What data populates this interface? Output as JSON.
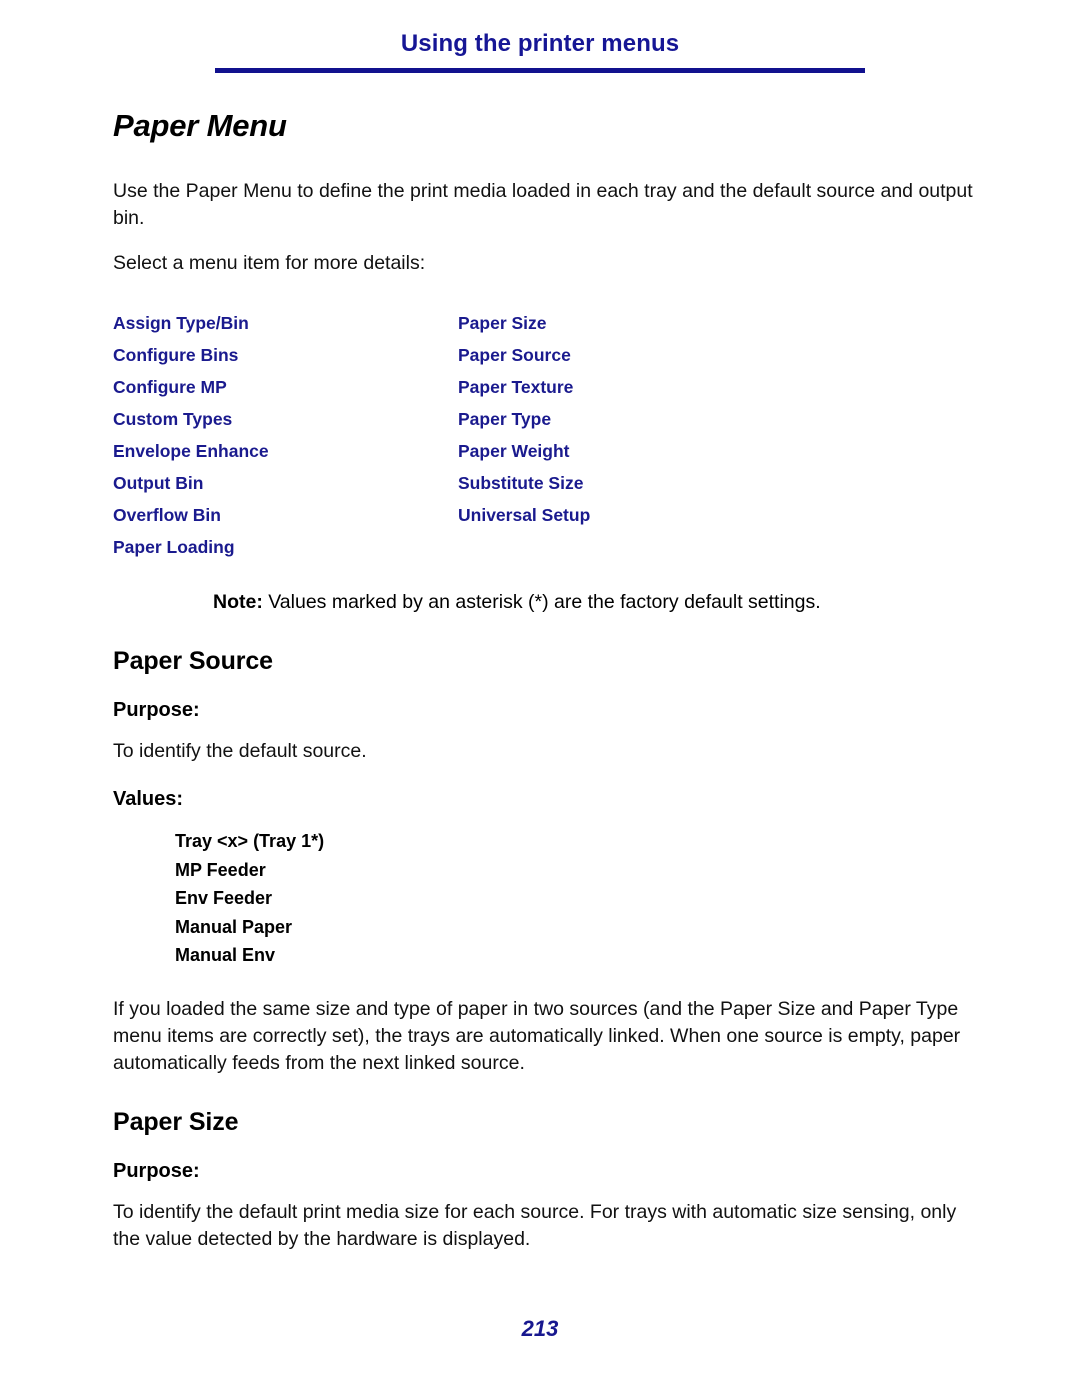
{
  "header": {
    "title": "Using the printer menus"
  },
  "document": {
    "title": "Paper Menu",
    "intro_paragraph": "Use the Paper Menu to define the print media loaded in each tray and the default source and output bin.",
    "select_prompt": "Select a menu item for more details:"
  },
  "menu_links": {
    "left_column": [
      "Assign Type/Bin",
      "Configure Bins",
      "Configure MP",
      "Custom Types",
      "Envelope Enhance",
      "Output Bin",
      "Overflow Bin",
      "Paper Loading"
    ],
    "right_column": [
      "Paper Size",
      "Paper Source",
      "Paper Texture",
      "Paper Type",
      "Paper Weight",
      "Substitute Size",
      "Universal Setup"
    ]
  },
  "note": {
    "label": "Note:",
    "text": "Values marked by an asterisk (*) are the factory default settings."
  },
  "paper_source_section": {
    "heading": "Paper Source",
    "purpose_label": "Purpose:",
    "purpose_text": "To identify the default source.",
    "values_label": "Values:",
    "values": [
      "Tray <x> (Tray 1*)",
      "MP Feeder",
      "Env Feeder",
      "Manual Paper",
      "Manual Env"
    ],
    "linking_paragraph": "If you loaded the same size and type of paper in two sources (and the Paper Size and Paper Type menu items are correctly set), the trays are automatically linked. When one source is empty, paper automatically feeds from the next linked source."
  },
  "paper_size_section": {
    "heading": "Paper Size",
    "purpose_label": "Purpose:",
    "purpose_text": "To identify the default print media size for each source. For trays with automatic size sensing, only the value detected by the hardware is displayed."
  },
  "footer": {
    "page_number": "213"
  },
  "colors": {
    "link_navy": "#1a1a8e",
    "header_navy": "#161695",
    "rule_navy": "#11118e",
    "body_black": "#111111"
  }
}
